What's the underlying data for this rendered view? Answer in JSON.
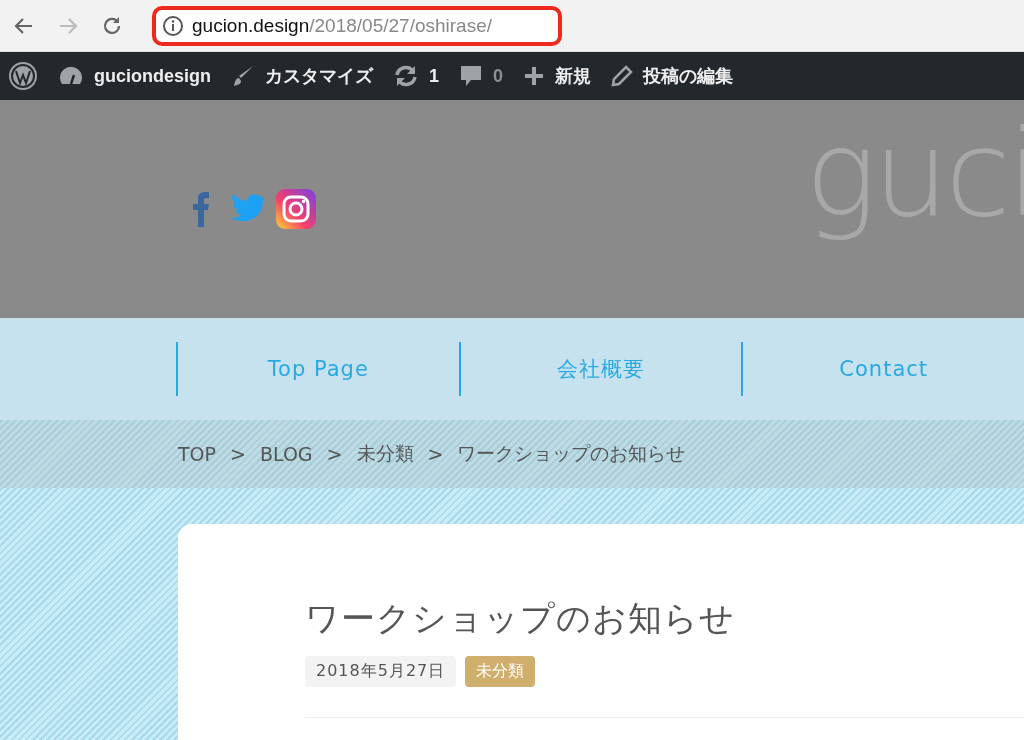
{
  "browser": {
    "url_host": "gucion.design",
    "url_path": "/2018/05/27/oshirase/"
  },
  "admin_bar": {
    "site": "guciondesign",
    "customize": "カスタマイズ",
    "updates": "1",
    "comments": "0",
    "new": "新規",
    "edit": "投稿の編集"
  },
  "header": {
    "logo": "guci"
  },
  "nav": [
    {
      "label": "Top Page"
    },
    {
      "label": "会社概要"
    },
    {
      "label": "Contact"
    }
  ],
  "breadcrumb": [
    {
      "label": "TOP"
    },
    {
      "label": "BLOG"
    },
    {
      "label": "未分類"
    },
    {
      "label": "ワークショップのお知らせ"
    }
  ],
  "breadcrumb_separator": ">",
  "post": {
    "title": "ワークショップのお知らせ",
    "date": "2018年5月27日",
    "category": "未分類"
  }
}
